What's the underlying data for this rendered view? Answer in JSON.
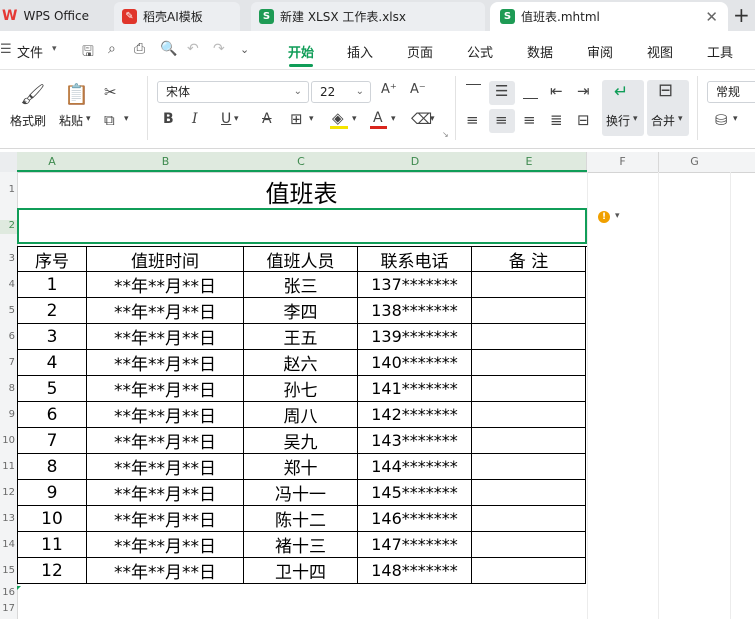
{
  "tabs": [
    {
      "label": "WPS Office",
      "icon": "wps-logo-icon"
    },
    {
      "label": "稻壳AI模板",
      "icon": "docer-icon"
    },
    {
      "label": "新建 XLSX 工作表.xlsx",
      "icon": "sheet-icon"
    },
    {
      "label": "值班表.mhtml",
      "icon": "sheet-icon"
    }
  ],
  "menu": {
    "file": "文件",
    "items": [
      "开始",
      "插入",
      "页面",
      "公式",
      "数据",
      "审阅",
      "视图",
      "工具"
    ],
    "active": "开始"
  },
  "ribbon": {
    "format_painter": "格式刷",
    "paste": "粘贴",
    "font_name": "宋体",
    "font_size": "22",
    "wrap": "换行",
    "merge": "合并",
    "number_format": "常规",
    "highlight_color": "#f5e400",
    "font_color": "#d9251d",
    "accent": "#109d58"
  },
  "sheet": {
    "columns": [
      "A",
      "B",
      "C",
      "D",
      "E",
      "F",
      "G"
    ],
    "rows": [
      "1",
      "2",
      "3",
      "4",
      "5",
      "6",
      "7",
      "8",
      "9",
      "10",
      "11",
      "12",
      "13",
      "14",
      "15",
      "16",
      "17"
    ],
    "title": "值班表",
    "headers": [
      "序号",
      "值班时间",
      "值班人员",
      "联系电话",
      "备  注"
    ],
    "data": [
      [
        "1",
        "**年**月**日",
        "张三",
        "137*******",
        ""
      ],
      [
        "2",
        "**年**月**日",
        "李四",
        "138*******",
        ""
      ],
      [
        "3",
        "**年**月**日",
        "王五",
        "139*******",
        ""
      ],
      [
        "4",
        "**年**月**日",
        "赵六",
        "140*******",
        ""
      ],
      [
        "5",
        "**年**月**日",
        "孙七",
        "141*******",
        ""
      ],
      [
        "6",
        "**年**月**日",
        "周八",
        "142*******",
        ""
      ],
      [
        "7",
        "**年**月**日",
        "吴九",
        "143*******",
        ""
      ],
      [
        "8",
        "**年**月**日",
        "郑十",
        "144*******",
        ""
      ],
      [
        "9",
        "**年**月**日",
        "冯十一",
        "145*******",
        ""
      ],
      [
        "10",
        "**年**月**日",
        "陈十二",
        "146*******",
        ""
      ],
      [
        "11",
        "**年**月**日",
        "褚十三",
        "147*******",
        ""
      ],
      [
        "12",
        "**年**月**日",
        "卫十四",
        "148*******",
        ""
      ]
    ]
  }
}
